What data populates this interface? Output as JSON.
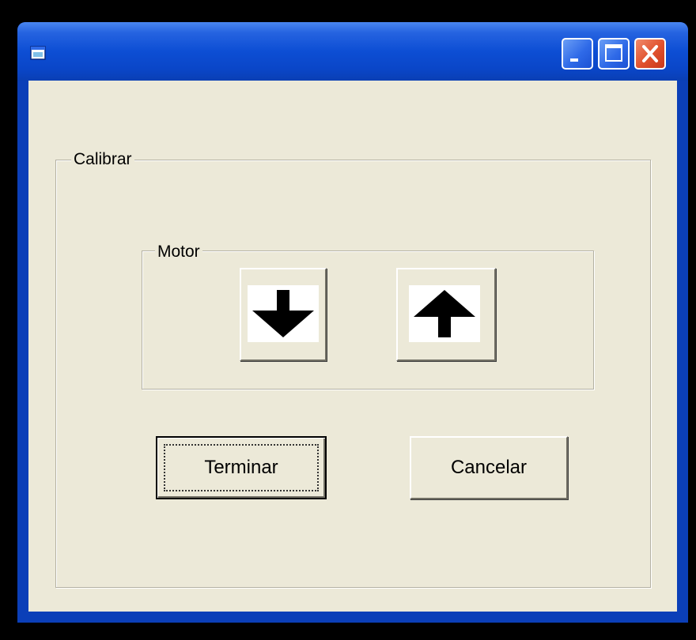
{
  "window": {
    "title": "",
    "icon": "app-window-icon",
    "controls": {
      "minimize_icon": "minimize-icon",
      "maximize_icon": "maximize-icon",
      "close_icon": "close-icon"
    }
  },
  "calibrar_group": {
    "label": "Calibrar"
  },
  "motor_group": {
    "label": "Motor",
    "down_icon": "arrow-down-icon",
    "up_icon": "arrow-up-icon"
  },
  "buttons": {
    "terminar_label": "Terminar",
    "cancelar_label": "Cancelar"
  },
  "colors": {
    "titlebar": "#0d4ed4",
    "client_background": "#ece9d8",
    "close_button": "#e0502c"
  }
}
